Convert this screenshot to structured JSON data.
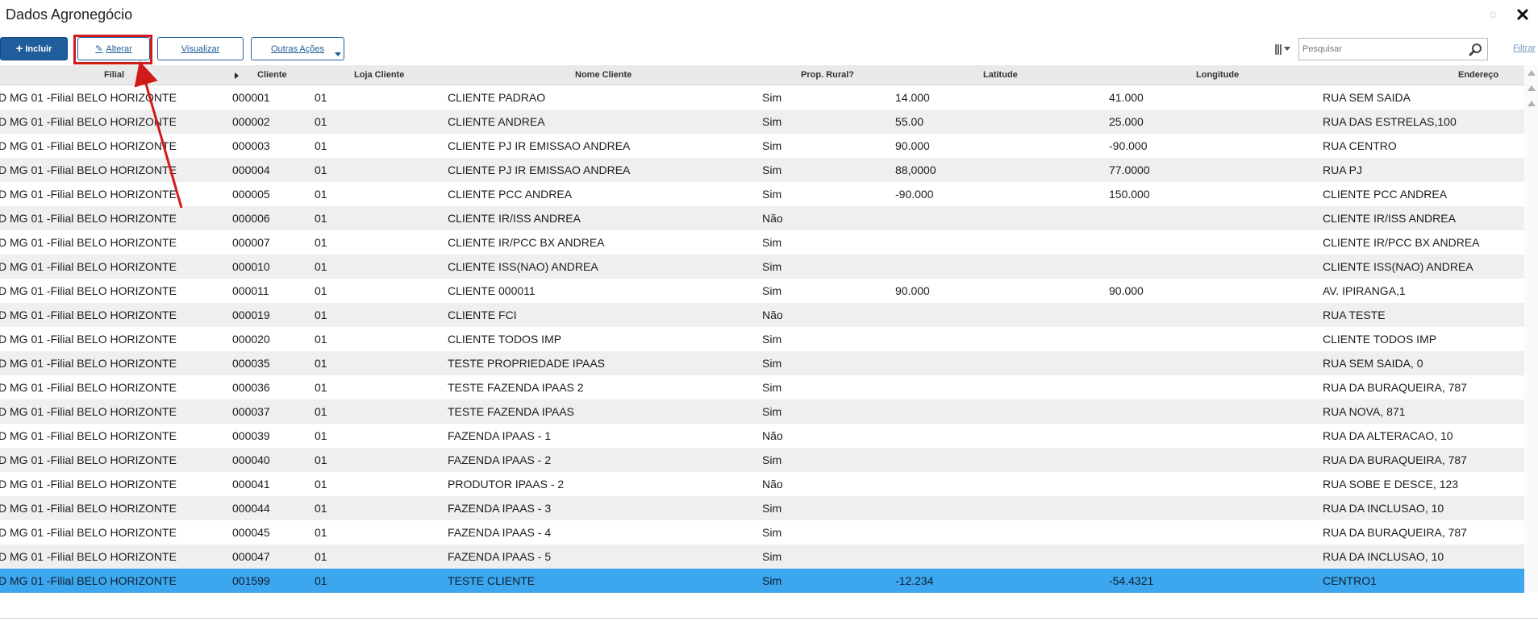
{
  "window": {
    "title": "Dados Agronegócio"
  },
  "toolbar": {
    "incluir_label": "Incluir",
    "alterar_label": "Alterar",
    "visualizar_label": "Visualizar",
    "outras_label": "Outras Ações"
  },
  "search": {
    "placeholder": "Pesquisar",
    "filter_label": "Filtrar"
  },
  "table": {
    "headers": {
      "filial": "Filial",
      "cliente": "Cliente",
      "loja": "Loja Cliente",
      "nome": "Nome Cliente",
      "prop": "Prop. Rural?",
      "lat": "Latitude",
      "lon": "Longitude",
      "end": "Endereço"
    },
    "rows": [
      {
        "filial": "D MG 01 -Filial BELO HORIZONTE",
        "cliente": "000001",
        "loja": "01",
        "nome": "CLIENTE PADRAO",
        "prop": "Sim",
        "lat": "14.000",
        "lon": "41.000",
        "end": "RUA SEM SAIDA"
      },
      {
        "filial": "D MG 01 -Filial BELO HORIZONTE",
        "cliente": "000002",
        "loja": "01",
        "nome": "CLIENTE ANDREA",
        "prop": "Sim",
        "lat": "55.00",
        "lon": "25.000",
        "end": "RUA DAS ESTRELAS,100"
      },
      {
        "filial": "D MG 01 -Filial BELO HORIZONTE",
        "cliente": "000003",
        "loja": "01",
        "nome": "CLIENTE PJ IR EMISSAO ANDREA",
        "prop": "Sim",
        "lat": "90.000",
        "lon": "-90.000",
        "end": "RUA CENTRO"
      },
      {
        "filial": "D MG 01 -Filial BELO HORIZONTE",
        "cliente": "000004",
        "loja": "01",
        "nome": "CLIENTE PJ IR EMISSAO ANDREA",
        "prop": "Sim",
        "lat": "88,0000",
        "lon": "77.0000",
        "end": "RUA PJ"
      },
      {
        "filial": "D MG 01 -Filial BELO HORIZONTE",
        "cliente": "000005",
        "loja": "01",
        "nome": "CLIENTE PCC ANDREA",
        "prop": "Sim",
        "lat": "-90.000",
        "lon": "150.000",
        "end": "CLIENTE PCC ANDREA"
      },
      {
        "filial": "D MG 01 -Filial BELO HORIZONTE",
        "cliente": "000006",
        "loja": "01",
        "nome": "CLIENTE IR/ISS ANDREA",
        "prop": "Não",
        "lat": "",
        "lon": "",
        "end": "CLIENTE IR/ISS ANDREA"
      },
      {
        "filial": "D MG 01 -Filial BELO HORIZONTE",
        "cliente": "000007",
        "loja": "01",
        "nome": "CLIENTE IR/PCC BX ANDREA",
        "prop": "Sim",
        "lat": "",
        "lon": "",
        "end": "CLIENTE IR/PCC BX ANDREA"
      },
      {
        "filial": "D MG 01 -Filial BELO HORIZONTE",
        "cliente": "000010",
        "loja": "01",
        "nome": "CLIENTE ISS(NAO) ANDREA",
        "prop": "Sim",
        "lat": "",
        "lon": "",
        "end": "CLIENTE ISS(NAO) ANDREA"
      },
      {
        "filial": "D MG 01 -Filial BELO HORIZONTE",
        "cliente": "000011",
        "loja": "01",
        "nome": "CLIENTE 000011",
        "prop": "Sim",
        "lat": "90.000",
        "lon": "90.000",
        "end": "AV. IPIRANGA,1"
      },
      {
        "filial": "D MG 01 -Filial BELO HORIZONTE",
        "cliente": "000019",
        "loja": "01",
        "nome": "CLIENTE FCI",
        "prop": "Não",
        "lat": "",
        "lon": "",
        "end": "RUA TESTE"
      },
      {
        "filial": "D MG 01 -Filial BELO HORIZONTE",
        "cliente": "000020",
        "loja": "01",
        "nome": "CLIENTE TODOS IMP",
        "prop": "Sim",
        "lat": "",
        "lon": "",
        "end": "CLIENTE TODOS IMP"
      },
      {
        "filial": "D MG 01 -Filial BELO HORIZONTE",
        "cliente": "000035",
        "loja": "01",
        "nome": "TESTE PROPRIEDADE IPAAS",
        "prop": "Sim",
        "lat": "",
        "lon": "",
        "end": "RUA SEM SAIDA, 0"
      },
      {
        "filial": "D MG 01 -Filial BELO HORIZONTE",
        "cliente": "000036",
        "loja": "01",
        "nome": "TESTE FAZENDA IPAAS 2",
        "prop": "Sim",
        "lat": "",
        "lon": "",
        "end": "RUA DA BURAQUEIRA, 787"
      },
      {
        "filial": "D MG 01 -Filial BELO HORIZONTE",
        "cliente": "000037",
        "loja": "01",
        "nome": "TESTE FAZENDA IPAAS",
        "prop": "Sim",
        "lat": "",
        "lon": "",
        "end": "RUA NOVA, 871"
      },
      {
        "filial": "D MG 01 -Filial BELO HORIZONTE",
        "cliente": "000039",
        "loja": "01",
        "nome": "FAZENDA IPAAS - 1",
        "prop": "Não",
        "lat": "",
        "lon": "",
        "end": "RUA DA ALTERACAO, 10"
      },
      {
        "filial": "D MG 01 -Filial BELO HORIZONTE",
        "cliente": "000040",
        "loja": "01",
        "nome": "FAZENDA IPAAS - 2",
        "prop": "Sim",
        "lat": "",
        "lon": "",
        "end": "RUA DA BURAQUEIRA, 787"
      },
      {
        "filial": "D MG 01 -Filial BELO HORIZONTE",
        "cliente": "000041",
        "loja": "01",
        "nome": "PRODUTOR IPAAS - 2",
        "prop": "Não",
        "lat": "",
        "lon": "",
        "end": "RUA SOBE E DESCE, 123"
      },
      {
        "filial": "D MG 01 -Filial BELO HORIZONTE",
        "cliente": "000044",
        "loja": "01",
        "nome": "FAZENDA IPAAS - 3",
        "prop": "Sim",
        "lat": "",
        "lon": "",
        "end": "RUA DA INCLUSAO, 10"
      },
      {
        "filial": "D MG 01 -Filial BELO HORIZONTE",
        "cliente": "000045",
        "loja": "01",
        "nome": "FAZENDA IPAAS - 4",
        "prop": "Sim",
        "lat": "",
        "lon": "",
        "end": "RUA DA BURAQUEIRA, 787"
      },
      {
        "filial": "D MG 01 -Filial BELO HORIZONTE",
        "cliente": "000047",
        "loja": "01",
        "nome": "FAZENDA IPAAS - 5",
        "prop": "Sim",
        "lat": "",
        "lon": "",
        "end": "RUA DA INCLUSAO, 10"
      },
      {
        "filial": "D MG 01 -Filial BELO HORIZONTE",
        "cliente": "001599",
        "loja": "01",
        "nome": "TESTE CLIENTE",
        "prop": "Sim",
        "lat": "-12.234",
        "lon": "-54.4321",
        "end": "CENTRO1"
      }
    ],
    "selected_row_index": 20
  },
  "colors": {
    "primary": "#1f5d9c",
    "selected_row": "#3ca6ee",
    "annotation_red": "#d11a1a",
    "header_bg": "#e9e9e9",
    "alt_row_bg": "#efefef"
  },
  "icons": [
    "gear-icon",
    "close-icon",
    "plus-icon",
    "pencil-icon",
    "chevron-down-icon",
    "columns-icon",
    "search-icon",
    "sort-caret-icon",
    "scroll-up-icon"
  ]
}
